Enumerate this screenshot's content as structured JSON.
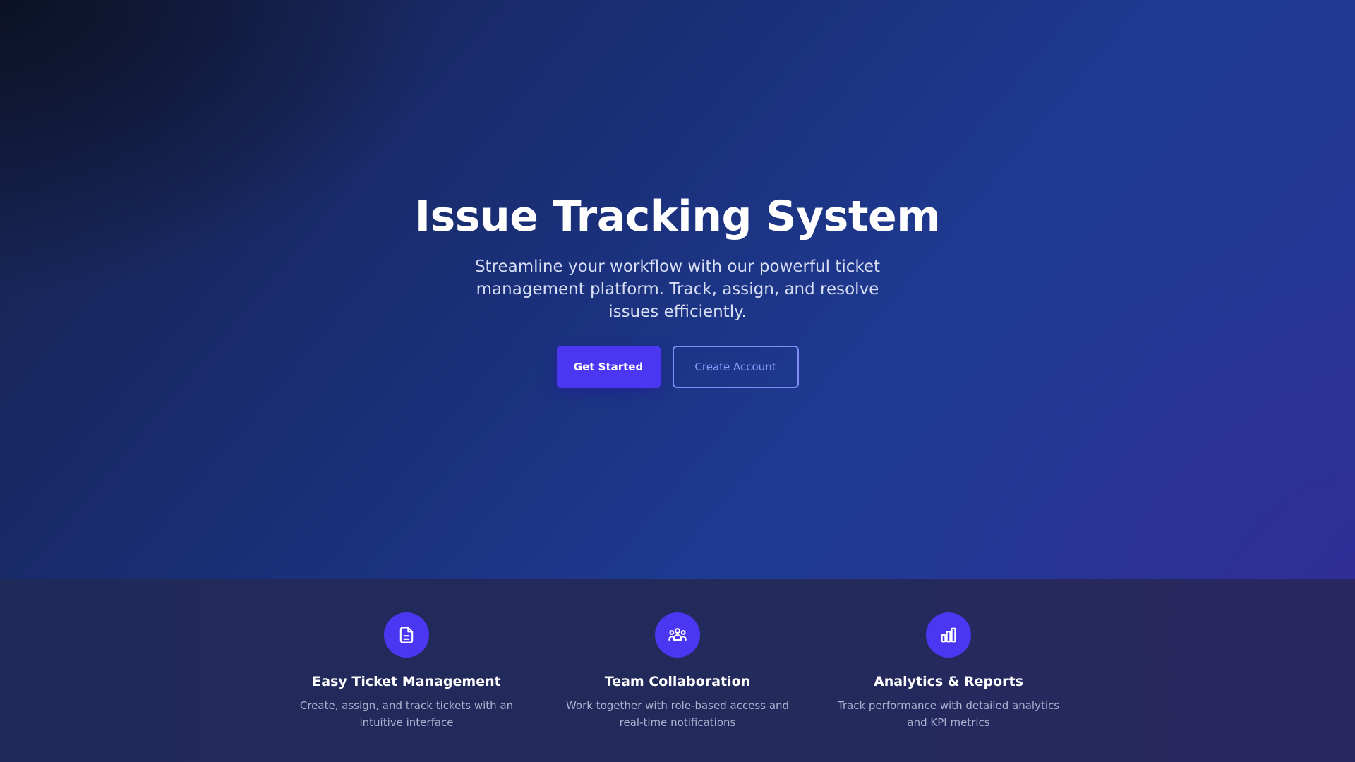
{
  "hero": {
    "title": "Issue Tracking System",
    "subtitle": "Streamline your workflow with our powerful ticket management platform. Track, assign, and resolve issues efficiently.",
    "primary_button": "Get Started",
    "secondary_button": "Create Account"
  },
  "features": [
    {
      "icon": "document-icon",
      "title": "Easy Ticket Management",
      "description": "Create, assign, and track tickets with an intuitive interface"
    },
    {
      "icon": "team-icon",
      "title": "Team Collaboration",
      "description": "Work together with role-based access and real-time notifications"
    },
    {
      "icon": "bar-chart-icon",
      "title": "Analytics & Reports",
      "description": "Track performance with detailed analytics and KPI metrics"
    }
  ],
  "colors": {
    "accent": "#4b37f2",
    "secondary_button_text": "#8f9cff",
    "hero_background": "#1f3a92",
    "features_background": "#222a5c"
  }
}
